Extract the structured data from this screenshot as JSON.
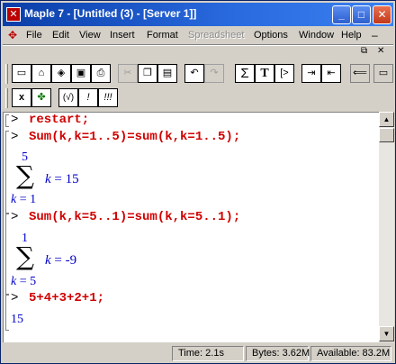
{
  "window": {
    "title": "Maple 7  - [Untitled (3) - [Server 1]]",
    "app_icon": "maple-leaf-icon"
  },
  "menu": {
    "items": [
      "File",
      "Edit",
      "View",
      "Insert",
      "Format",
      "Spreadsheet",
      "Options",
      "Window",
      "Help"
    ],
    "disabled": [
      "Spreadsheet"
    ]
  },
  "toolbar": {
    "row1": [
      "new-icon",
      "open-icon",
      "open-url-icon",
      "save-icon",
      "print-icon",
      "cut-icon",
      "copy-icon",
      "paste-icon",
      "undo-icon",
      "redo-icon",
      "sum-icon",
      "text-icon",
      "insert-prompt-icon",
      "indent-icon",
      "outdent-icon",
      "back-icon",
      "stop-icon"
    ],
    "row2": [
      "x-icon",
      "maple-leaf-icon",
      "eval-icon",
      "execute-icon",
      "execute-all-icon"
    ],
    "labels": {
      "sum": "Σ",
      "text": "T",
      "prompt": "[>",
      "x": "x",
      "eval": "(√)",
      "exec": "!",
      "execall": "!!!"
    }
  },
  "worksheet": {
    "prompt_symbol": ">",
    "lines": [
      {
        "input": "restart;"
      },
      {
        "input": "Sum(k,k=1..5)=sum(k,k=1..5);"
      },
      {
        "input": "Sum(k,k=5..1)=sum(k,k=5..1);"
      },
      {
        "input": "5+4+3+2+1;"
      }
    ],
    "outputs": [
      {
        "upper": "5",
        "lower": "k = 1",
        "body": "k = 15"
      },
      {
        "upper": "1",
        "lower": "k = 5",
        "body": "k = -9"
      },
      {
        "value": "15"
      }
    ]
  },
  "status": {
    "time": "Time:  2.1s",
    "bytes": "Bytes: 3.62M",
    "available": "Available: 83.2M"
  }
}
